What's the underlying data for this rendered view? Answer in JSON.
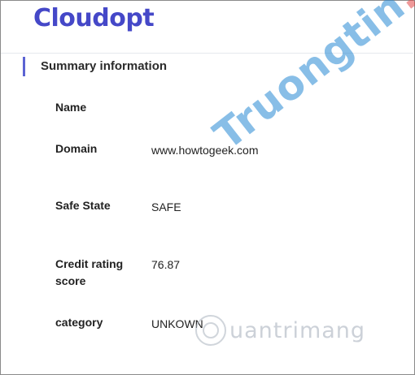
{
  "app": {
    "logo_text": "Cloudopt",
    "accent_color": "#4548c8"
  },
  "summary": {
    "title": "Summary information",
    "rows": [
      {
        "label": "Name",
        "value": ""
      },
      {
        "label": "Domain",
        "value": "www.howtogeek.com"
      },
      {
        "label": "Safe State",
        "value": "SAFE"
      },
      {
        "label": "Credit rating score",
        "label_line1": "Credit rating",
        "label_line2": "score",
        "value": "76.87"
      },
      {
        "label": "category",
        "value": "UNKOWN"
      }
    ]
  },
  "watermarks": {
    "top_part1": "Truongtin",
    "top_part2": ".top",
    "bottom": "uantrimang"
  }
}
